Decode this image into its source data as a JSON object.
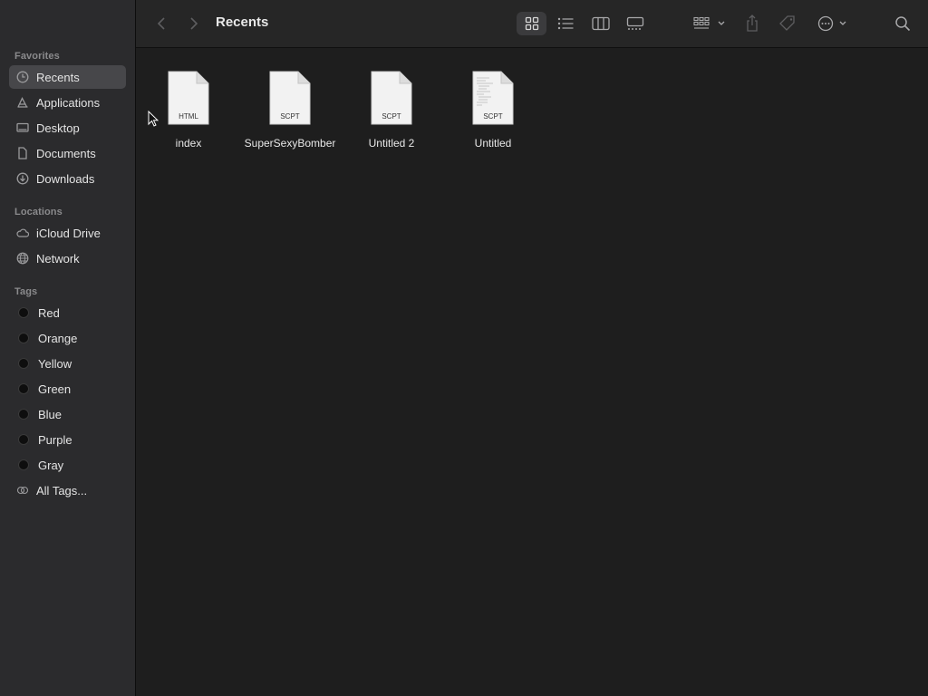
{
  "sidebar": {
    "favorites_title": "Favorites",
    "favorites": [
      {
        "label": "Recents",
        "icon": "clock-icon",
        "selected": true
      },
      {
        "label": "Applications",
        "icon": "applications-icon"
      },
      {
        "label": "Desktop",
        "icon": "desktop-icon"
      },
      {
        "label": "Documents",
        "icon": "document-icon"
      },
      {
        "label": "Downloads",
        "icon": "download-icon"
      }
    ],
    "locations_title": "Locations",
    "locations": [
      {
        "label": "iCloud Drive",
        "icon": "cloud-icon"
      },
      {
        "label": "Network",
        "icon": "globe-icon"
      }
    ],
    "tags_title": "Tags",
    "tags": [
      {
        "label": "Red"
      },
      {
        "label": "Orange"
      },
      {
        "label": "Yellow"
      },
      {
        "label": "Green"
      },
      {
        "label": "Blue"
      },
      {
        "label": "Purple"
      },
      {
        "label": "Gray"
      }
    ],
    "all_tags": "All Tags..."
  },
  "toolbar": {
    "title": "Recents",
    "view_mode": "icon"
  },
  "files": [
    {
      "name": "index",
      "kind": "HTML"
    },
    {
      "name": "SuperSexyBomber",
      "kind": "SCPT"
    },
    {
      "name": "Untitled 2",
      "kind": "SCPT"
    },
    {
      "name": "Untitled",
      "kind": "SCPT"
    }
  ],
  "colors": {
    "sidebar_bg": "#2b2b2d",
    "content_bg": "#1e1e1e",
    "selection": "#47474a"
  }
}
